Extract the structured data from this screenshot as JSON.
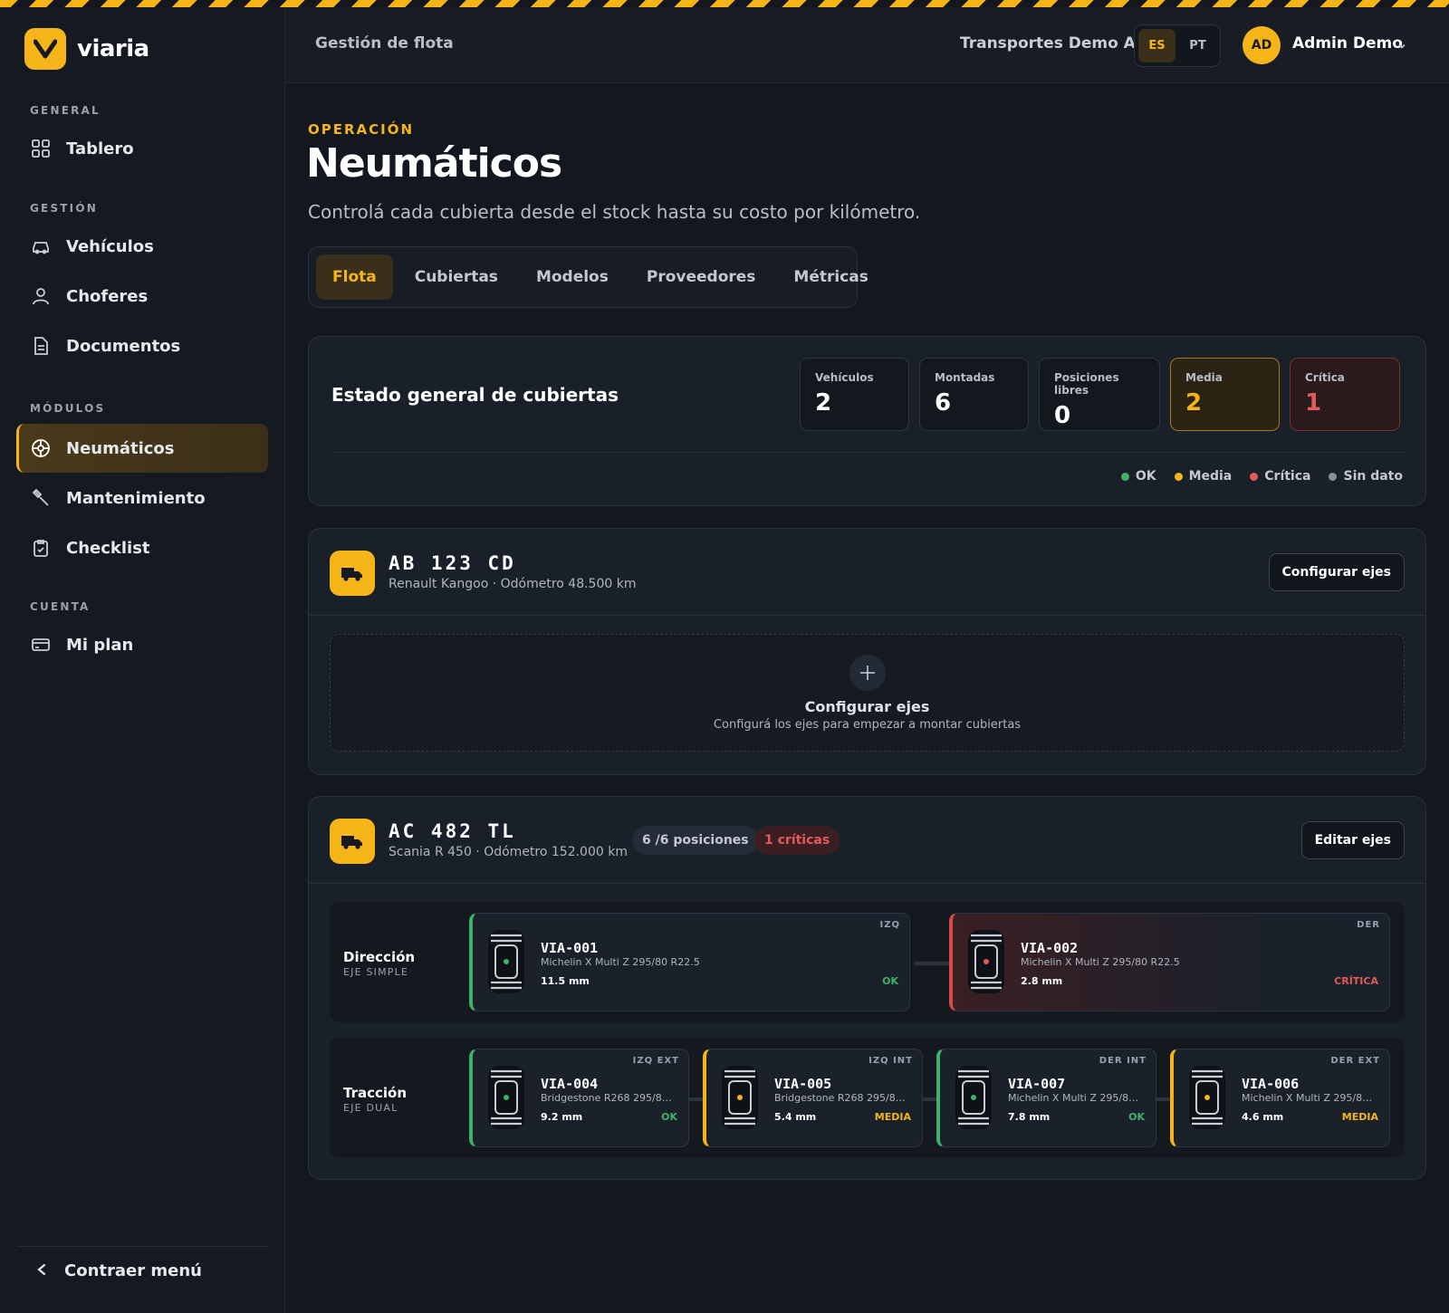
{
  "brand": {
    "name": "viaria",
    "accent": "#f5b518"
  },
  "sidebar": {
    "sections": {
      "general": "GENERAL",
      "gestion": "GESTIÓN",
      "modulos": "MÓDULOS",
      "cuenta": "CUENTA"
    },
    "items": [
      {
        "label": "Tablero",
        "icon": "grid-icon"
      },
      {
        "label": "Vehículos",
        "icon": "car-icon"
      },
      {
        "label": "Choferes",
        "icon": "user-icon"
      },
      {
        "label": "Documentos",
        "icon": "document-icon"
      },
      {
        "label": "Neumáticos",
        "icon": "tire-icon",
        "active": true
      },
      {
        "label": "Mantenimiento",
        "icon": "wrench-icon"
      },
      {
        "label": "Checklist",
        "icon": "clipboard-check-icon"
      },
      {
        "label": "Mi plan",
        "icon": "credit-card-icon"
      }
    ],
    "collapse_label": "Contraer menú"
  },
  "topbar": {
    "title": "Gestión de flota",
    "company": "Transportes Demo AR",
    "languages": [
      "ES",
      "PT"
    ],
    "selected_language": "ES",
    "avatar_initials": "AD",
    "user_name": "Admin Demo"
  },
  "page": {
    "eyebrow": "OPERACIÓN",
    "title": "Neumáticos",
    "subtitle": "Controlá cada cubierta desde el stock hasta su costo por kilómetro."
  },
  "tabs": [
    "Flota",
    "Cubiertas",
    "Modelos",
    "Proveedores",
    "Métricas"
  ],
  "summary": {
    "title": "Estado general de cubiertas",
    "stats": [
      {
        "label": "Vehículos",
        "value": "2"
      },
      {
        "label": "Montadas",
        "value": "6"
      },
      {
        "label": "Posiciones libres",
        "value": "0"
      },
      {
        "label": "Media",
        "value": "2"
      },
      {
        "label": "Crítica",
        "value": "1"
      }
    ],
    "legend": [
      {
        "label": "OK",
        "color": "#3cb36b"
      },
      {
        "label": "Media",
        "color": "#f5b518"
      },
      {
        "label": "Crítica",
        "color": "#e25a5a"
      },
      {
        "label": "Sin dato",
        "color": "#8a909a"
      }
    ]
  },
  "vehicles": [
    {
      "plate": "AB 123 CD",
      "meta": "Renault Kangoo · Odómetro 48.500 km",
      "action": "Configurar ejes",
      "empty": {
        "title": "Configurar ejes",
        "subtitle": "Configurá los ejes para empezar a montar cubiertas"
      }
    },
    {
      "plate": "AC 482 TL",
      "meta": "Scania R 450 · Odómetro 152.000 km",
      "positions_badge": "6 /6 posiciones",
      "critical_badge": "1 críticas",
      "action": "Editar ejes",
      "axles": [
        {
          "name": "Dirección",
          "type": "EJE SIMPLE",
          "tires": [
            {
              "pos": "IZQ",
              "code": "VIA-001",
              "model": "Michelin X Multi Z 295/80 R22.5",
              "depth": "11.5 mm",
              "status": "OK"
            },
            {
              "pos": "DER",
              "code": "VIA-002",
              "model": "Michelin X Multi Z 295/80 R22.5",
              "depth": "2.8 mm",
              "status": "CRÍTICA"
            }
          ]
        },
        {
          "name": "Tracción",
          "type": "EJE DUAL",
          "tires": [
            {
              "pos": "IZQ EXT",
              "code": "VIA-004",
              "model": "Bridgestone R268 295/80...",
              "depth": "9.2 mm",
              "status": "OK"
            },
            {
              "pos": "IZQ INT",
              "code": "VIA-005",
              "model": "Bridgestone R268 295/80...",
              "depth": "5.4 mm",
              "status": "MEDIA"
            },
            {
              "pos": "DER INT",
              "code": "VIA-007",
              "model": "Michelin X Multi Z 295/80...",
              "depth": "7.8 mm",
              "status": "OK"
            },
            {
              "pos": "DER EXT",
              "code": "VIA-006",
              "model": "Michelin X Multi Z 295/80...",
              "depth": "4.6 mm",
              "status": "MEDIA"
            }
          ]
        }
      ]
    }
  ]
}
